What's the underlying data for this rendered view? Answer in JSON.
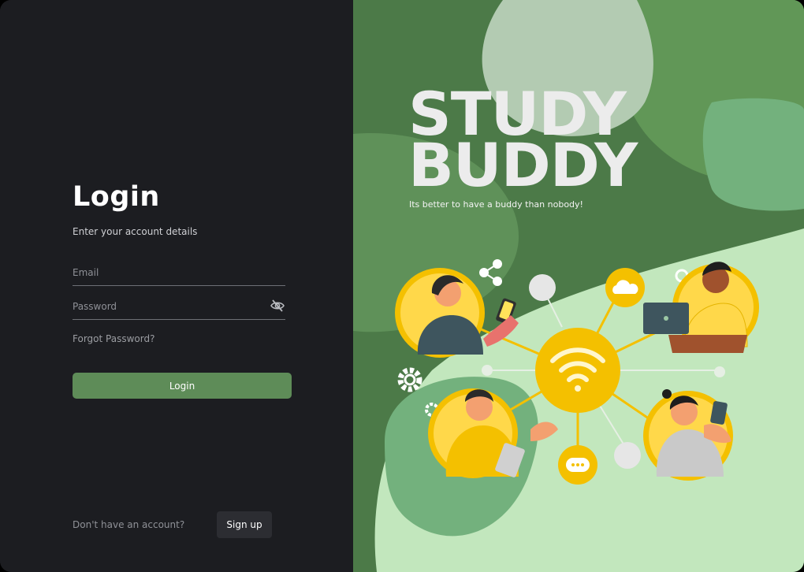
{
  "login": {
    "title": "Login",
    "subtitle": "Enter your account details",
    "email_placeholder": "Email",
    "password_placeholder": "Password",
    "forgot_password": "Forgot Password?",
    "login_button": "Login",
    "no_account_text": "Don't have an account?",
    "signup_button": "Sign up"
  },
  "brand": {
    "line1": "STUDY",
    "line2": "BUDDY",
    "tagline": "Its better to have a buddy than nobody!"
  },
  "icons": {
    "password_toggle": "eye-off-icon",
    "illustration": "study-network-illustration"
  },
  "colors": {
    "panel_dark": "#1c1d21",
    "accent_green": "#5e8c58",
    "dark_green": "#4c7a48",
    "light_green": "#c2e7bd",
    "yellow": "#f4c000"
  }
}
